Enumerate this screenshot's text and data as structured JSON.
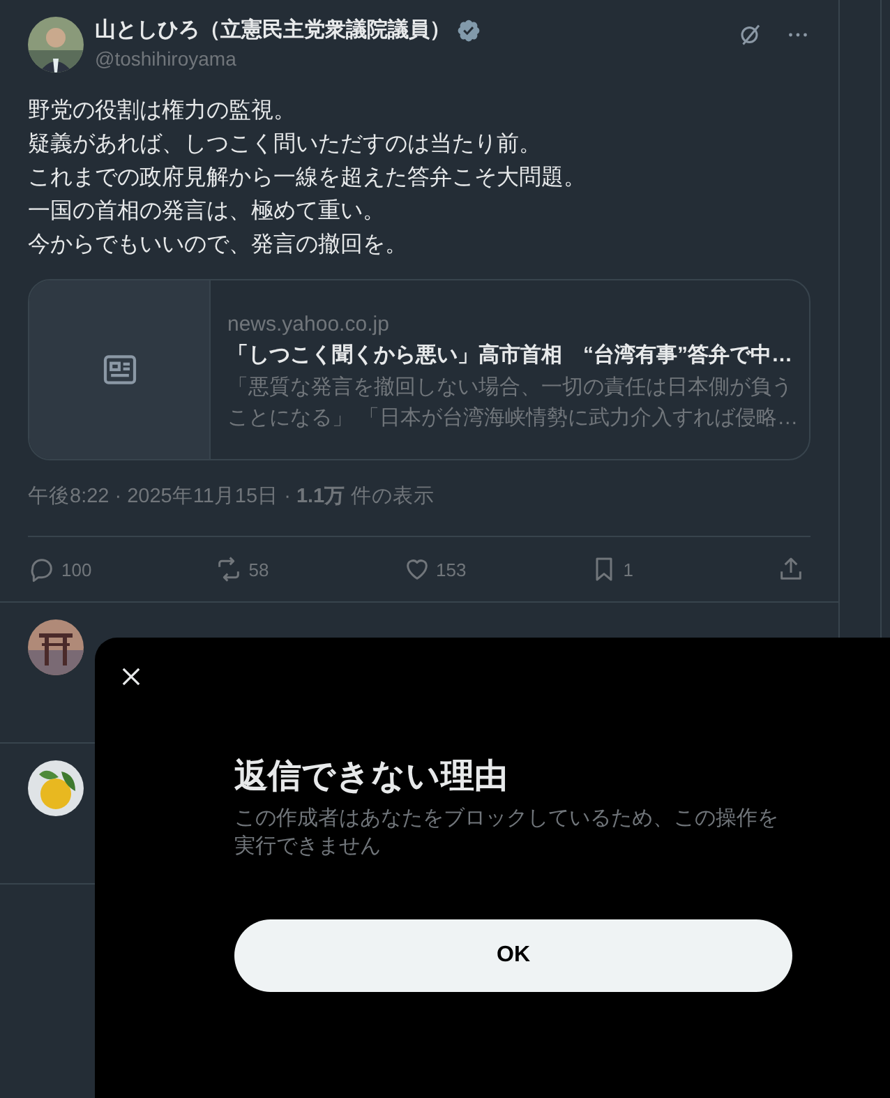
{
  "post": {
    "author_name": "山としひろ（立憲民主党衆議院議員）",
    "verified": true,
    "handle": "@toshihiroyama",
    "text_lines": [
      "野党の役割は権力の監視。",
      "疑義があれば、しつこく問いただすのは当たり前。",
      "これまでの政府見解から一線を超えた答弁こそ大問題。",
      "一国の首相の発言は、極めて重い。",
      "今からでもいいので、発言の撤回を。"
    ],
    "link_card": {
      "domain": "news.yahoo.co.jp",
      "title": "「しつこく聞くから悪い」高市首相　“台湾有事”答弁で中…",
      "description": "「悪質な発言を撤回しない場合、一切の責任は日本側が負うことになる」 「日本が台湾海峡情勢に武力介入すれば侵略…"
    },
    "meta": "午後8:22 · 2025年11月15日 · **1.1万** 件の表示",
    "actions": [
      {
        "kind": "reply",
        "count": "100"
      },
      {
        "kind": "repost",
        "count": "58"
      },
      {
        "kind": "like",
        "count": "153"
      },
      {
        "kind": "bookmark",
        "count": "1"
      },
      {
        "kind": "share"
      }
    ]
  },
  "dialog": {
    "title": "返信できない理由",
    "message": "この作成者はあなたをブロックしているため、この操作を実行できません",
    "button": "OK"
  }
}
